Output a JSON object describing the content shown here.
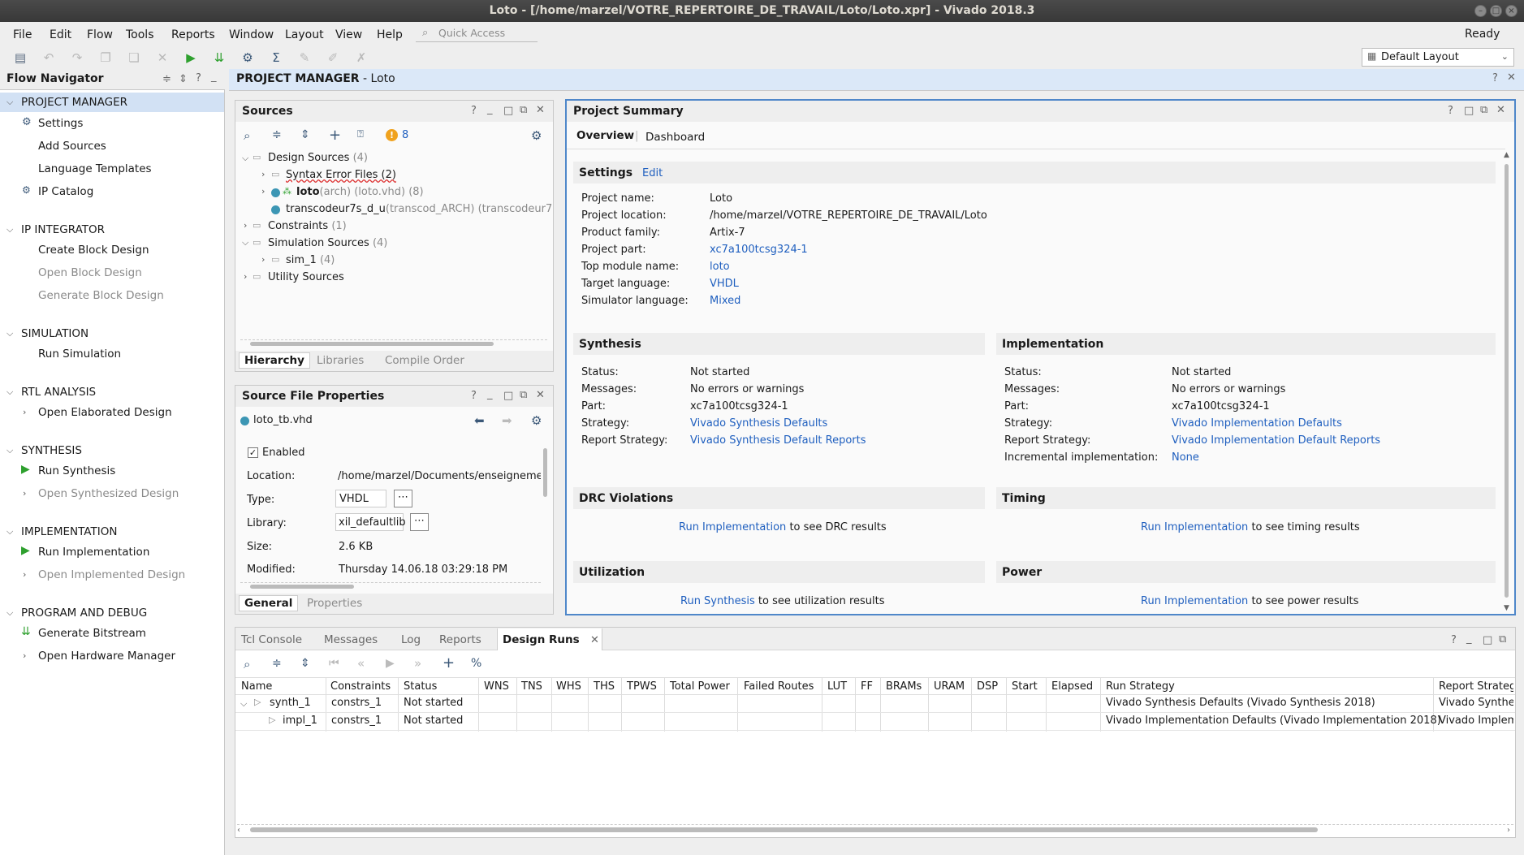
{
  "window": {
    "title": "Loto - [/home/marzel/VOTRE_REPERTOIRE_DE_TRAVAIL/Loto/Loto.xpr] - Vivado 2018.3"
  },
  "menu": {
    "items": [
      "File",
      "Edit",
      "Flow",
      "Tools",
      "Reports",
      "Window",
      "Layout",
      "View",
      "Help"
    ],
    "quick_access_placeholder": "Quick Access",
    "status": "Ready",
    "layout_select": "Default Layout"
  },
  "flow_navigator": {
    "title": "Flow Navigator",
    "sections": [
      {
        "label": "PROJECT MANAGER",
        "items": [
          "Settings",
          "Add Sources",
          "Language Templates",
          "IP Catalog"
        ]
      },
      {
        "label": "IP INTEGRATOR",
        "items": [
          "Create Block Design",
          "Open Block Design",
          "Generate Block Design"
        ]
      },
      {
        "label": "SIMULATION",
        "items": [
          "Run Simulation"
        ]
      },
      {
        "label": "RTL ANALYSIS",
        "items": [
          "Open Elaborated Design"
        ]
      },
      {
        "label": "SYNTHESIS",
        "items": [
          "Run Synthesis",
          "Open Synthesized Design"
        ]
      },
      {
        "label": "IMPLEMENTATION",
        "items": [
          "Run Implementation",
          "Open Implemented Design"
        ]
      },
      {
        "label": "PROGRAM AND DEBUG",
        "items": [
          "Generate Bitstream",
          "Open Hardware Manager"
        ]
      }
    ]
  },
  "main_header": {
    "title": "PROJECT MANAGER",
    "project": "- Loto"
  },
  "sources": {
    "title": "Sources",
    "warning_count": "8",
    "tree": {
      "design_sources": "Design Sources",
      "design_sources_count": "(4)",
      "syntax_error_files": "Syntax Error Files (2)",
      "loto_name": "loto",
      "loto_detail": "(arch) (loto.vhd) (8)",
      "transcodeur_name": "transcodeur7s_d_u",
      "transcodeur_detail": "(transcod_ARCH) (transcodeur7s",
      "constraints": "Constraints",
      "constraints_count": "(1)",
      "simulation_sources": "Simulation Sources",
      "simulation_sources_count": "(4)",
      "sim_1": "sim_1",
      "sim_1_count": "(4)",
      "utility_sources": "Utility Sources"
    },
    "tabs": [
      "Hierarchy",
      "Libraries",
      "Compile Order"
    ]
  },
  "source_file_properties": {
    "title": "Source File Properties",
    "file": "loto_tb.vhd",
    "enabled_label": "Enabled",
    "location_label": "Location:",
    "location_value": "/home/marzel/Documents/enseignement",
    "type_label": "Type:",
    "type_value": "VHDL",
    "library_label": "Library:",
    "library_value": "xil_defaultlib",
    "size_label": "Size:",
    "size_value": "2.6 KB",
    "modified_label": "Modified:",
    "modified_value": "Thursday 14.06.18 03:29:18 PM",
    "tabs": [
      "General",
      "Properties"
    ]
  },
  "project_summary": {
    "title": "Project Summary",
    "tabs": [
      "Overview",
      "Dashboard"
    ],
    "settings": {
      "title": "Settings",
      "edit": "Edit",
      "rows": [
        {
          "label": "Project name:",
          "value": "Loto"
        },
        {
          "label": "Project location:",
          "value": "/home/marzel/VOTRE_REPERTOIRE_DE_TRAVAIL/Loto"
        },
        {
          "label": "Product family:",
          "value": "Artix-7"
        },
        {
          "label": "Project part:",
          "value": "xc7a100tcsg324-1"
        },
        {
          "label": "Top module name:",
          "value": "loto"
        },
        {
          "label": "Target language:",
          "value": "VHDL"
        },
        {
          "label": "Simulator language:",
          "value": "Mixed"
        }
      ]
    },
    "synthesis": {
      "title": "Synthesis",
      "rows": [
        {
          "label": "Status:",
          "value": "Not started"
        },
        {
          "label": "Messages:",
          "value": "No errors or warnings"
        },
        {
          "label": "Part:",
          "value": "xc7a100tcsg324-1"
        },
        {
          "label": "Strategy:",
          "value": "Vivado Synthesis Defaults"
        },
        {
          "label": "Report Strategy:",
          "value": "Vivado Synthesis Default Reports"
        }
      ]
    },
    "implementation": {
      "title": "Implementation",
      "rows": [
        {
          "label": "Status:",
          "value": "Not started"
        },
        {
          "label": "Messages:",
          "value": "No errors or warnings"
        },
        {
          "label": "Part:",
          "value": "xc7a100tcsg324-1"
        },
        {
          "label": "Strategy:",
          "value": "Vivado Implementation Defaults"
        },
        {
          "label": "Report Strategy:",
          "value": "Vivado Implementation Default Reports"
        },
        {
          "label": "Incremental implementation:",
          "value": "None"
        }
      ]
    },
    "drc": {
      "title": "DRC Violations",
      "link": "Run Implementation",
      "text": "to see DRC results"
    },
    "timing": {
      "title": "Timing",
      "link": "Run Implementation",
      "text": "to see timing results"
    },
    "utilization": {
      "title": "Utilization",
      "link": "Run Synthesis",
      "text": "to see utilization results"
    },
    "power": {
      "title": "Power",
      "link": "Run Implementation",
      "text": "to see power results"
    }
  },
  "bottom": {
    "tabs": [
      "Tcl Console",
      "Messages",
      "Log",
      "Reports",
      "Design Runs"
    ],
    "columns": [
      "Name",
      "Constraints",
      "Status",
      "WNS",
      "TNS",
      "WHS",
      "THS",
      "TPWS",
      "Total Power",
      "Failed Routes",
      "LUT",
      "FF",
      "BRAMs",
      "URAM",
      "DSP",
      "Start",
      "Elapsed",
      "Run Strategy",
      "Report Strateg"
    ],
    "rows": [
      {
        "name": "synth_1",
        "constraints": "constrs_1",
        "status": "Not started",
        "run_strategy": "Vivado Synthesis Defaults (Vivado Synthesis 2018)",
        "report_strategy": "Vivado Synthes"
      },
      {
        "name": "impl_1",
        "constraints": "constrs_1",
        "status": "Not started",
        "run_strategy": "Vivado Implementation Defaults (Vivado Implementation 2018)",
        "report_strategy": "Vivado Impleme"
      }
    ]
  }
}
